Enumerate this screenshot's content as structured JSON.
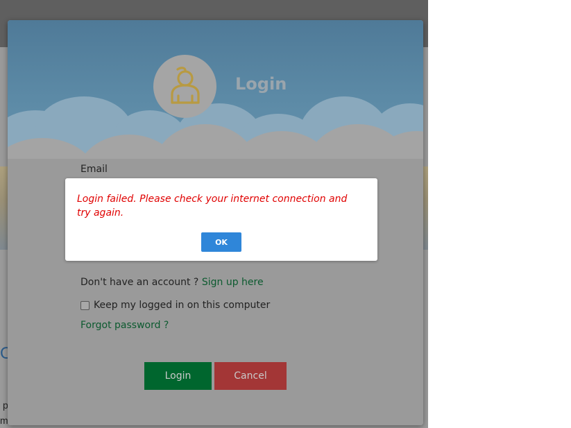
{
  "background": {
    "fragment_1": "O",
    "fragment_2": "p",
    "fragment_3": "m"
  },
  "login_modal": {
    "title": "Login",
    "avatar_icon": "user-icon",
    "email_label": "Email",
    "signup_prompt": "Don't have an account ? ",
    "signup_link": "Sign up here",
    "keep_logged_in_label": "Keep my logged in on this computer",
    "forgot_password": "Forgot password ?",
    "login_button": "Login",
    "cancel_button": "Cancel"
  },
  "alert": {
    "message": "Login failed. Please check your internet connection and try again.",
    "ok_button": "OK"
  },
  "colors": {
    "header_blue": "#5c8aa6",
    "login_green": "#00662e",
    "cancel_red": "#a33636",
    "error_red": "#e00000",
    "ok_blue": "#2f86d9",
    "link_green": "#0c5a2f"
  }
}
